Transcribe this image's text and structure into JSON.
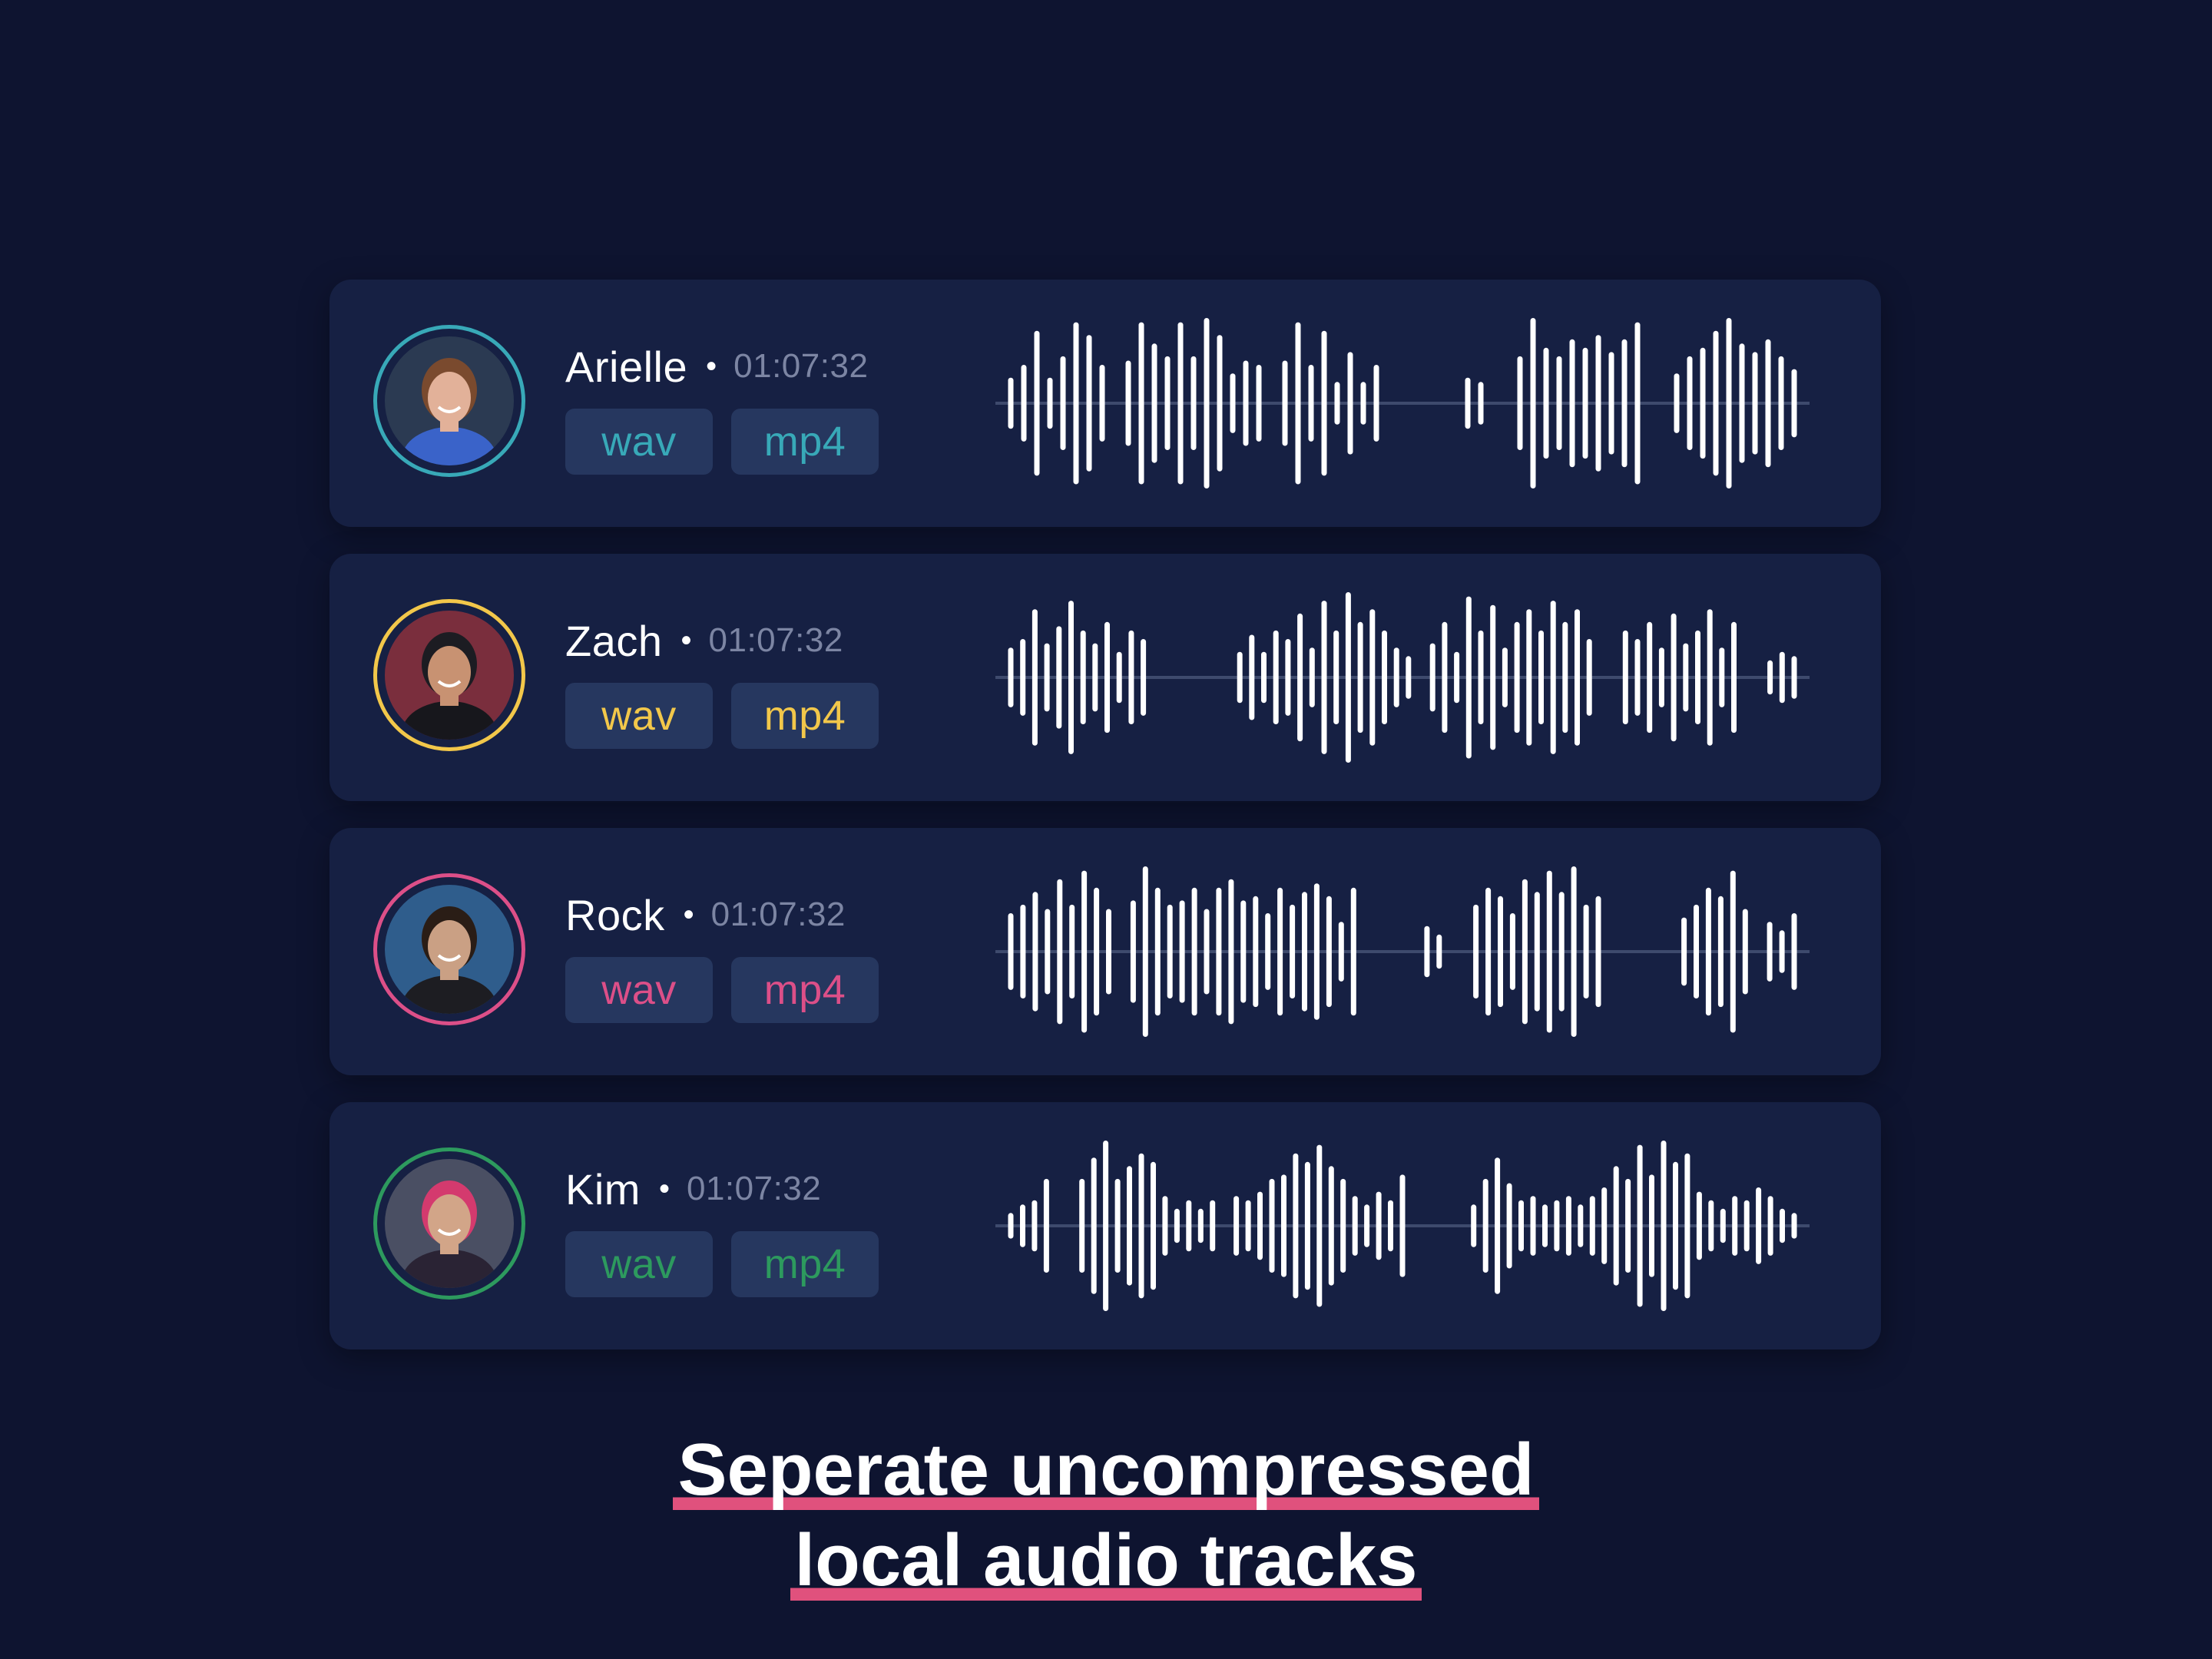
{
  "tracks": [
    {
      "name": "Arielle",
      "separator": "•",
      "timestamp": "01:07:32",
      "accent": "#38a9b8",
      "formats": [
        "wav",
        "mp4"
      ],
      "avatar_icon": "person-avatar-icon",
      "waveform_levels": [
        0.3,
        0.45,
        0.85,
        0.3,
        0.55,
        0.95,
        0.8,
        0.45,
        0,
        0.5,
        0.95,
        0.7,
        0.55,
        0.95,
        0.55,
        1.0,
        0.8,
        0.35,
        0.5,
        0.45,
        0,
        0.5,
        0.95,
        0.45,
        0.85,
        0.25,
        0.6,
        0.25,
        0.45,
        0,
        0,
        0,
        0,
        0,
        0,
        0.3,
        0.25,
        0,
        0,
        0.55,
        1.0,
        0.65,
        0.55,
        0.75,
        0.65,
        0.8,
        0.6,
        0.75,
        0.95,
        0,
        0,
        0.35,
        0.55,
        0.65,
        0.85,
        1.0,
        0.7,
        0.6,
        0.75,
        0.55,
        0.4
      ],
      "waveform_color": "#ffffff"
    },
    {
      "name": "Zach",
      "separator": "•",
      "timestamp": "01:07:32",
      "accent": "#f2c74a",
      "formats": [
        "wav",
        "mp4"
      ],
      "avatar_icon": "person-avatar-icon",
      "waveform_levels": [
        0.35,
        0.45,
        0.8,
        0.4,
        0.6,
        0.9,
        0.55,
        0.4,
        0.65,
        0.3,
        0.55,
        0.45,
        0,
        0,
        0,
        0,
        0,
        0,
        0,
        0.3,
        0.5,
        0.3,
        0.55,
        0.45,
        0.75,
        0.35,
        0.9,
        0.55,
        1.0,
        0.65,
        0.8,
        0.55,
        0.35,
        0.25,
        0,
        0.4,
        0.65,
        0.3,
        0.95,
        0.55,
        0.85,
        0.35,
        0.65,
        0.8,
        0.55,
        0.9,
        0.65,
        0.8,
        0.45,
        0,
        0,
        0.55,
        0.45,
        0.65,
        0.35,
        0.75,
        0.4,
        0.55,
        0.8,
        0.35,
        0.65,
        0,
        0,
        0.2,
        0.3,
        0.25
      ],
      "waveform_color": "#ffffff"
    },
    {
      "name": "Rock",
      "separator": "•",
      "timestamp": "01:07:32",
      "accent": "#dc4f88",
      "formats": [
        "wav",
        "mp4"
      ],
      "avatar_icon": "person-avatar-icon",
      "waveform_levels": [
        0.45,
        0.55,
        0.7,
        0.5,
        0.85,
        0.55,
        0.95,
        0.75,
        0.5,
        0,
        0.6,
        1.0,
        0.75,
        0.55,
        0.6,
        0.75,
        0.5,
        0.75,
        0.85,
        0.6,
        0.65,
        0.45,
        0.75,
        0.55,
        0.7,
        0.8,
        0.65,
        0.35,
        0.75,
        0,
        0,
        0,
        0,
        0,
        0.3,
        0.2,
        0,
        0,
        0.55,
        0.75,
        0.65,
        0.45,
        0.85,
        0.7,
        0.95,
        0.7,
        1.0,
        0.55,
        0.65,
        0,
        0,
        0,
        0,
        0,
        0,
        0.4,
        0.55,
        0.75,
        0.65,
        0.95,
        0.5,
        0,
        0.35,
        0.25,
        0.45
      ],
      "waveform_color": "#ffffff"
    },
    {
      "name": "Kim",
      "separator": "•",
      "timestamp": "01:07:32",
      "accent": "#2d9a5e",
      "formats": [
        "wav",
        "mp4"
      ],
      "avatar_icon": "person-avatar-icon",
      "waveform_levels": [
        0.15,
        0.25,
        0.3,
        0.55,
        0,
        0,
        0.55,
        0.8,
        1.0,
        0.55,
        0.7,
        0.85,
        0.75,
        0.35,
        0.2,
        0.3,
        0.2,
        0.3,
        0,
        0.35,
        0.3,
        0.4,
        0.55,
        0.6,
        0.85,
        0.75,
        0.95,
        0.7,
        0.55,
        0.35,
        0.25,
        0.4,
        0.3,
        0.6,
        0,
        0,
        0,
        0,
        0,
        0.25,
        0.55,
        0.8,
        0.5,
        0.3,
        0.35,
        0.25,
        0.3,
        0.35,
        0.25,
        0.35,
        0.45,
        0.7,
        0.55,
        0.95,
        0.6,
        1.0,
        0.75,
        0.85,
        0.4,
        0.3,
        0.2,
        0.35,
        0.3,
        0.45,
        0.35,
        0.2,
        0.15
      ],
      "waveform_color": "#ffffff"
    }
  ],
  "caption": {
    "line1": "Seperate uncompressed",
    "line2": "local audio tracks",
    "underline_color": "#e0517d"
  }
}
